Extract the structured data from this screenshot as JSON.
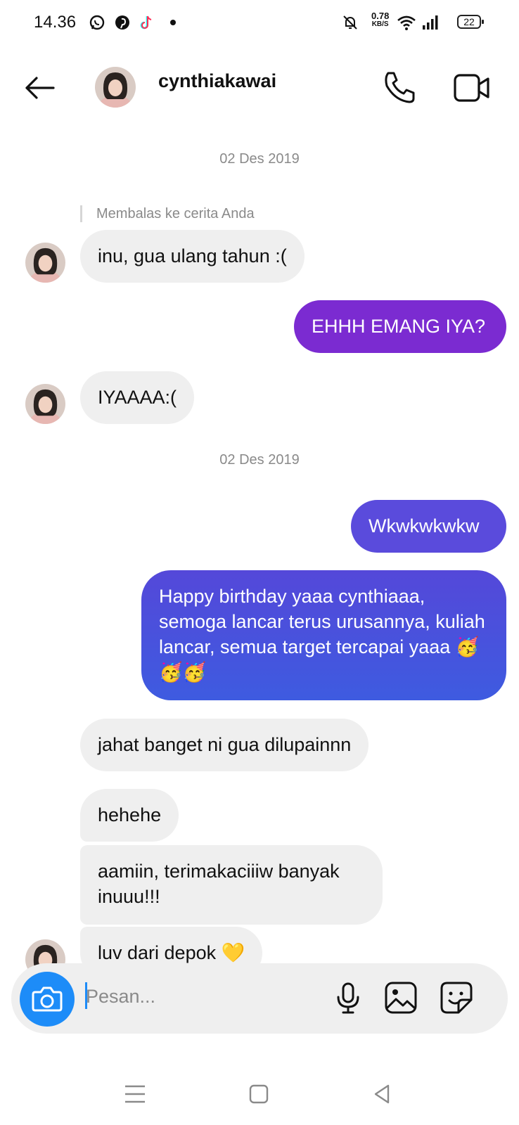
{
  "status_bar": {
    "time": "14.36",
    "net_speed_value": "0.78",
    "net_speed_unit": "KB/S",
    "battery": "22"
  },
  "header": {
    "username": "cynthiakawai"
  },
  "conversation": {
    "date_1": "02 Des 2019",
    "reply_label": "Membalas ke cerita Anda",
    "msg_1": "inu, gua ulang tahun :(",
    "msg_2": "EHHH EMANG IYA?",
    "msg_3": "IYAAAA:(",
    "date_2": "02 Des 2019",
    "msg_4": "Wkwkwkwkw",
    "msg_5": "Happy birthday yaaa cynthiaaa, semoga lancar terus urusannya, kuliah lancar, semua target tercapai yaaa 🥳🥳🥳",
    "msg_6": "jahat banget ni gua dilupainnn",
    "msg_7": "hehehe",
    "msg_8": "aamiin, terimakaciiiw banyak inuuu!!!",
    "msg_9": "luv dari depok 💛"
  },
  "composer": {
    "placeholder": "Pesan..."
  },
  "colors": {
    "bubble_in": "#efefef",
    "bubble_out_purple": "#7b2bd1",
    "bubble_out_indigo": "#5a4bdc",
    "bubble_out_blue": "#3e5be0",
    "camera_blue": "#1d8cf8"
  },
  "icons": [
    "whatsapp-icon",
    "pinterest-icon",
    "tiktok-icon",
    "mute-icon",
    "wifi-icon",
    "signal-icon",
    "back-arrow-icon",
    "phone-icon",
    "video-camera-icon",
    "camera-icon",
    "microphone-icon",
    "gallery-icon",
    "sticker-icon",
    "menu-icon",
    "home-icon",
    "back-nav-icon"
  ]
}
